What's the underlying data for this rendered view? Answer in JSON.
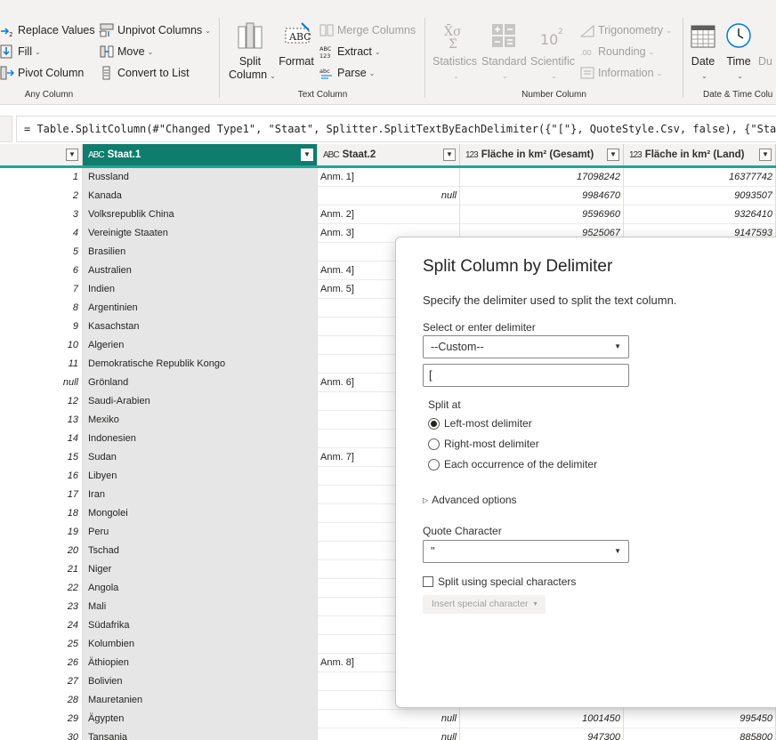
{
  "ribbon": {
    "any_column": {
      "label": "Any Column",
      "replace_values": "Replace Values",
      "fill": "Fill",
      "pivot_column": "Pivot Column",
      "unpivot_columns": "Unpivot Columns",
      "move": "Move",
      "convert_to_list": "Convert to List"
    },
    "text_column": {
      "label": "Text Column",
      "split_column": "Split",
      "split_column_2": "Column",
      "format": "Format",
      "merge_columns": "Merge Columns",
      "extract": "Extract",
      "parse": "Parse"
    },
    "number_column": {
      "label": "Number Column",
      "statistics": "Statistics",
      "standard": "Standard",
      "scientific": "Scientific",
      "trigonometry": "Trigonometry",
      "rounding": "Rounding",
      "information": "Information"
    },
    "datetime_column": {
      "label": "Date & Time Colu",
      "date": "Date",
      "time": "Time",
      "duration": "Du"
    }
  },
  "formula_bar": {
    "formula": "= Table.SplitColumn(#\"Changed Type1\", \"Staat\", Splitter.SplitTextByEachDelimiter({\"[\"}, QuoteStyle.Csv, false), {\"Staat.1\", \"Staat.2\"})"
  },
  "grid": {
    "columns": [
      {
        "name": "Staat.1",
        "type_icon": "ABC"
      },
      {
        "name": "Staat.2",
        "type_icon": "ABC"
      },
      {
        "name": "Fläche in km² (Gesamt)",
        "type_icon": "123"
      },
      {
        "name": "Fläche in km² (Land)",
        "type_icon": "123"
      }
    ],
    "rows": [
      {
        "idx": "1",
        "s1": "Russland",
        "s2": "Anm. 1]",
        "fg": "17098242",
        "fl": "16377742"
      },
      {
        "idx": "2",
        "s1": "Kanada",
        "s2": "null",
        "fg": "9984670",
        "fl": "9093507"
      },
      {
        "idx": "3",
        "s1": "Volksrepublik China",
        "s2": "Anm. 2]",
        "fg": "9596960",
        "fl": "9326410"
      },
      {
        "idx": "4",
        "s1": "Vereinigte Staaten",
        "s2": "Anm. 3]",
        "fg": "9525067",
        "fl": "9147593"
      },
      {
        "idx": "5",
        "s1": "Brasilien",
        "s2": "",
        "fg": "",
        "fl": ""
      },
      {
        "idx": "6",
        "s1": "Australien",
        "s2": "Anm. 4]",
        "fg": "",
        "fl": ""
      },
      {
        "idx": "7",
        "s1": "Indien",
        "s2": "Anm. 5]",
        "fg": "",
        "fl": ""
      },
      {
        "idx": "8",
        "s1": "Argentinien",
        "s2": "",
        "fg": "",
        "fl": ""
      },
      {
        "idx": "9",
        "s1": "Kasachstan",
        "s2": "",
        "fg": "",
        "fl": ""
      },
      {
        "idx": "10",
        "s1": "Algerien",
        "s2": "",
        "fg": "",
        "fl": ""
      },
      {
        "idx": "11",
        "s1": "Demokratische Republik Kongo",
        "s2": "",
        "fg": "",
        "fl": ""
      },
      {
        "idx": "null",
        "s1": "Grönland",
        "s2": "Anm. 6]",
        "fg": "",
        "fl": ""
      },
      {
        "idx": "12",
        "s1": "Saudi-Arabien",
        "s2": "",
        "fg": "",
        "fl": ""
      },
      {
        "idx": "13",
        "s1": "Mexiko",
        "s2": "",
        "fg": "",
        "fl": ""
      },
      {
        "idx": "14",
        "s1": "Indonesien",
        "s2": "",
        "fg": "",
        "fl": ""
      },
      {
        "idx": "15",
        "s1": "Sudan",
        "s2": "Anm. 7]",
        "fg": "",
        "fl": ""
      },
      {
        "idx": "16",
        "s1": "Libyen",
        "s2": "",
        "fg": "",
        "fl": ""
      },
      {
        "idx": "17",
        "s1": "Iran",
        "s2": "",
        "fg": "",
        "fl": ""
      },
      {
        "idx": "18",
        "s1": "Mongolei",
        "s2": "",
        "fg": "",
        "fl": ""
      },
      {
        "idx": "19",
        "s1": "Peru",
        "s2": "",
        "fg": "",
        "fl": ""
      },
      {
        "idx": "20",
        "s1": "Tschad",
        "s2": "",
        "fg": "",
        "fl": ""
      },
      {
        "idx": "21",
        "s1": "Niger",
        "s2": "",
        "fg": "",
        "fl": ""
      },
      {
        "idx": "22",
        "s1": "Angola",
        "s2": "",
        "fg": "",
        "fl": ""
      },
      {
        "idx": "23",
        "s1": "Mali",
        "s2": "",
        "fg": "",
        "fl": ""
      },
      {
        "idx": "24",
        "s1": "Südafrika",
        "s2": "",
        "fg": "",
        "fl": ""
      },
      {
        "idx": "25",
        "s1": "Kolumbien",
        "s2": "",
        "fg": "",
        "fl": ""
      },
      {
        "idx": "26",
        "s1": "Äthiopien",
        "s2": "Anm. 8]",
        "fg": "",
        "fl": ""
      },
      {
        "idx": "27",
        "s1": "Bolivien",
        "s2": "",
        "fg": "",
        "fl": ""
      },
      {
        "idx": "28",
        "s1": "Mauretanien",
        "s2": "",
        "fg": "",
        "fl": ""
      },
      {
        "idx": "29",
        "s1": "Ägypten",
        "s2": "null",
        "fg": "1001450",
        "fl": "995450"
      },
      {
        "idx": "30",
        "s1": "Tansania",
        "s2": "null",
        "fg": "947300",
        "fl": "885800"
      }
    ]
  },
  "dialog": {
    "title": "Split Column by Delimiter",
    "description": "Specify the delimiter used to split the text column.",
    "delimiter_label": "Select or enter delimiter",
    "delimiter_selected": "--Custom--",
    "delimiter_value": "[",
    "split_at_label": "Split at",
    "split_options": [
      {
        "label": "Left-most delimiter",
        "checked": true
      },
      {
        "label": "Right-most delimiter",
        "checked": false
      },
      {
        "label": "Each occurrence of the delimiter",
        "checked": false
      }
    ],
    "advanced_options": "Advanced options",
    "quote_char_label": "Quote Character",
    "quote_char_value": "\"",
    "special_chars_label": "Split using special characters",
    "insert_special_label": "Insert special character"
  },
  "colors": {
    "selected_header": "#107c6d",
    "quality_bar": "#1aa89a",
    "selected_column_bg": "#e6e6e6"
  }
}
